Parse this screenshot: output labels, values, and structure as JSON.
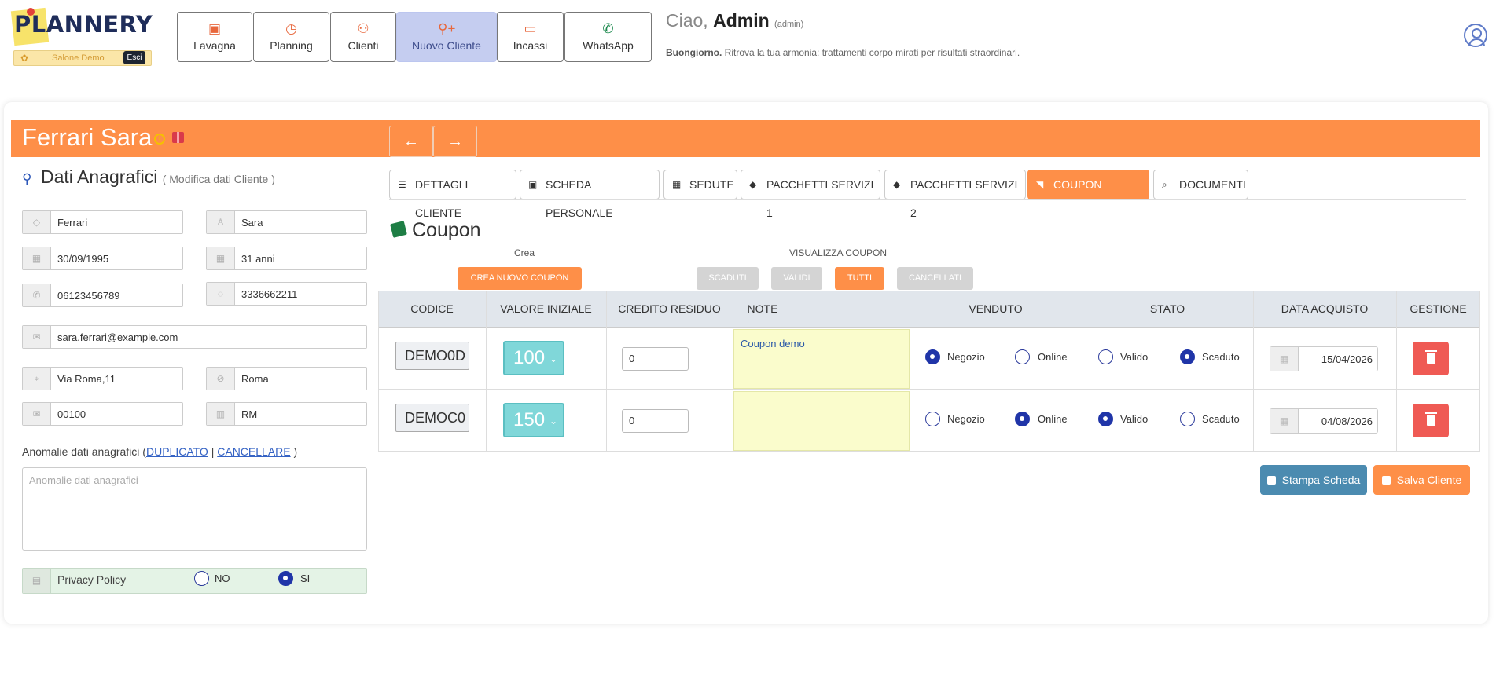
{
  "app": {
    "logo": "PLANNERY",
    "salon_name": "Salone Demo",
    "exit_label": "Esci"
  },
  "nav": [
    {
      "label": "Lavagna",
      "icon": "clipboard-icon"
    },
    {
      "label": "Planning",
      "icon": "calendar-clock-icon"
    },
    {
      "label": "Clienti",
      "icon": "users-icon"
    },
    {
      "label": "Nuovo Cliente",
      "icon": "user-plus-icon"
    },
    {
      "label": "Incassi",
      "icon": "cash-icon"
    },
    {
      "label": "WhatsApp",
      "icon": "whatsapp-icon"
    }
  ],
  "greeting": {
    "hello": "Ciao,",
    "user": "Admin",
    "role": "(admin)",
    "bold": "Buongiorno.",
    "message": "Ritrova la tua armonia: trattamenti corpo mirati per risultati straordinari."
  },
  "client": {
    "name": "Ferrari Sara"
  },
  "nav_arrows": {
    "prev": "←",
    "next": "→"
  },
  "dati": {
    "title": "Dati Anagrafici",
    "subtitle": "( Modifica dati Cliente )",
    "cognome": "Ferrari",
    "nome": "Sara",
    "data_nascita": "30/09/1995",
    "eta": "31 anni",
    "telefono": "06123456789",
    "cellulare": "3336662211",
    "email": "sara.ferrari@example.com",
    "indirizzo": "Via Roma,11",
    "citta": "Roma",
    "cap": "00100",
    "provincia": "RM",
    "anomalie_label": "Anomalie dati anagrafici (",
    "anomalie_dup": "DUPLICATO",
    "anomalie_sep": "|",
    "anomalie_canc": "CANCELLARE",
    "anomalie_close": ")",
    "anomalie_placeholder": "Anomalie dati anagrafici",
    "privacy_label": "Privacy Policy",
    "privacy_no": "NO",
    "privacy_si": "SI",
    "privacy_value": "SI"
  },
  "tabs": [
    {
      "label": "DETTAGLI CLIENTE",
      "active": false
    },
    {
      "label": "SCHEDA PERSONALE",
      "active": false
    },
    {
      "label": "SEDUTE",
      "active": false
    },
    {
      "label": "PACCHETTI SERVIZI 1",
      "active": false
    },
    {
      "label": "PACCHETTI SERVIZI 2",
      "active": false
    },
    {
      "label": "COUPON SALONE",
      "active": true
    },
    {
      "label": "DOCUMENTI",
      "active": false
    }
  ],
  "coupon": {
    "title": "Coupon",
    "crea_label": "Crea",
    "crea_button": "CREA NUOVO COUPON",
    "visualizza_label": "VISUALIZZA COUPON",
    "filters": [
      "SCADUTI",
      "VALIDI",
      "TUTTI",
      "CANCELLATI"
    ],
    "active_filter": "TUTTI",
    "columns": [
      "CODICE",
      "VALORE INIZIALE",
      "CREDITO RESIDUO",
      "NOTE",
      "VENDUTO",
      "STATO",
      "DATA ACQUISTO",
      "GESTIONE"
    ],
    "venduto_options": [
      "Negozio",
      "Online"
    ],
    "stato_options": [
      "Valido",
      "Scaduto"
    ],
    "rows": [
      {
        "codice": "DEMO0D",
        "valore": "100",
        "credito": "0",
        "note": "Coupon demo",
        "venduto": "Negozio",
        "stato": "Scaduto",
        "data": "15/04/2026"
      },
      {
        "codice": "DEMOC0",
        "valore": "150",
        "credito": "0",
        "note": "",
        "venduto": "Online",
        "stato": "Valido",
        "data": "04/08/2026"
      }
    ]
  },
  "actions": {
    "stampa": "Stampa Scheda",
    "salva": "Salva Cliente"
  },
  "colors": {
    "accent": "#fe8f48",
    "primary": "#2035a8",
    "nav_active": "#c5cdf0",
    "note_bg": "#fafccc",
    "delete": "#ef5a54"
  }
}
